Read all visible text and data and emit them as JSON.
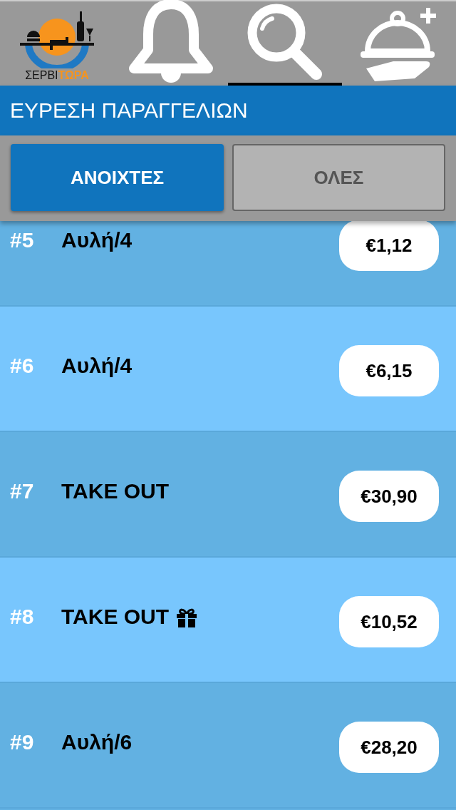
{
  "nav_tabs": [
    {
      "kind": "logo",
      "logo_text": [
        "ΣΕΡΒΙ",
        "ΤΩΡΑ"
      ],
      "selected": false
    },
    {
      "kind": "bell",
      "selected": false
    },
    {
      "kind": "search",
      "selected": true
    },
    {
      "kind": "cloche",
      "selected": false
    }
  ],
  "header": {
    "title": "ΕΥΡΕΣΗ ΠΑΡΑΓΓΕΛΙΩΝ"
  },
  "filter_tabs": [
    {
      "label": "ΑΝΟΙΧΤΕΣ",
      "selected": true
    },
    {
      "label": "ΟΛΕΣ",
      "selected": false
    }
  ],
  "orders": [
    {
      "number": "#5",
      "table": "Αυλή/4",
      "gift": false,
      "price": "€1,12"
    },
    {
      "number": "#6",
      "table": "Αυλή/4",
      "gift": false,
      "price": "€6,15"
    },
    {
      "number": "#7",
      "table": "TAKE OUT",
      "gift": false,
      "price": "€30,90"
    },
    {
      "number": "#8",
      "table": "TAKE OUT",
      "gift": true,
      "price": "€10,52"
    },
    {
      "number": "#9",
      "table": "Αυλή/6",
      "gift": false,
      "price": "€28,20"
    }
  ]
}
